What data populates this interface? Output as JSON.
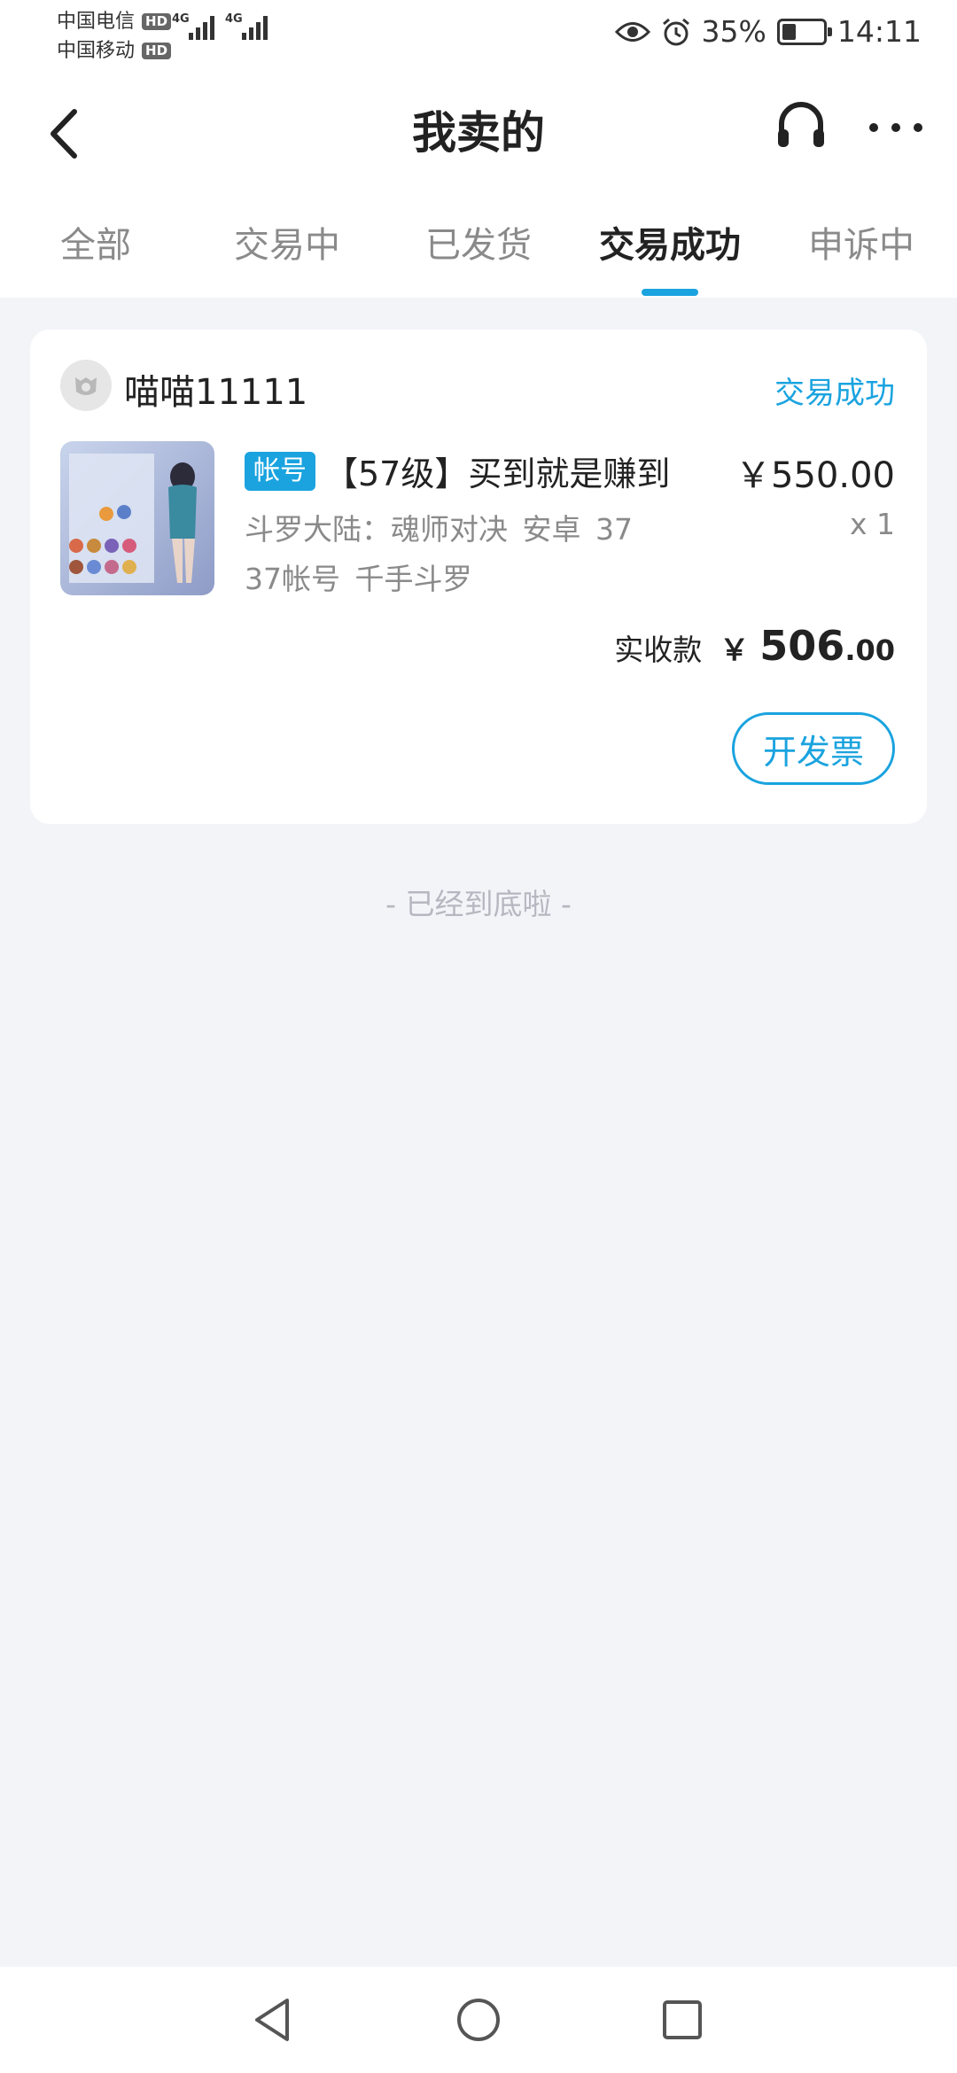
{
  "status_bar": {
    "carrier1": "中国电信",
    "carrier2": "中国移动",
    "hd_badge": "HD",
    "network1": "4G",
    "network2": "4G",
    "battery_percent": "35%",
    "battery_level": 0.35,
    "time": "14:11",
    "icons": [
      "eye-icon",
      "alarm-icon",
      "battery-icon"
    ]
  },
  "header": {
    "title": "我卖的",
    "back_icon": "chevron-left-icon",
    "support_icon": "headset-icon",
    "more_icon": "more-horizontal-icon"
  },
  "tabs": [
    {
      "label": "全部"
    },
    {
      "label": "交易中"
    },
    {
      "label": "已发货"
    },
    {
      "label": "交易成功",
      "active": true
    },
    {
      "label": "申诉中"
    }
  ],
  "order": {
    "seller_name": "喵喵11111",
    "status": "交易成功",
    "badge": "帐号",
    "title": "【57级】买到就是赚到",
    "price": "￥550.00",
    "description": "斗罗大陆：魂师对决 安卓 37 37帐号 千手斗罗",
    "quantity": "x 1",
    "received_label": "实收款",
    "received_currency": "￥",
    "received_int": "506",
    "received_dec": ".00",
    "invoice_button": "开发票"
  },
  "list_end": "- 已经到底啦 -",
  "colors": {
    "accent": "#1aa3df",
    "background": "#f3f4f8",
    "text_primary": "#222222",
    "text_secondary": "#8a8a8a"
  }
}
